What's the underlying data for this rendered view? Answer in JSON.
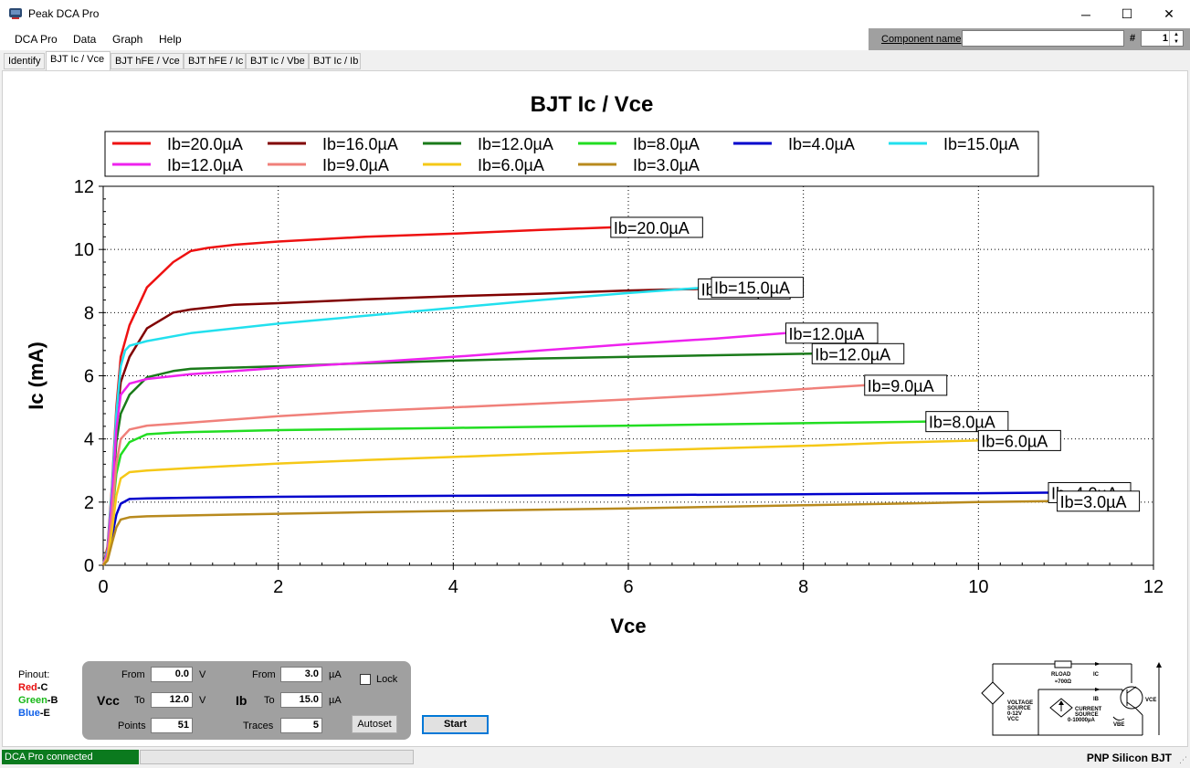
{
  "window": {
    "title": "Peak DCA Pro",
    "minimize": "─",
    "maximize": "☐",
    "close": "✕"
  },
  "menu": [
    "DCA Pro",
    "Data",
    "Graph",
    "Help"
  ],
  "component": {
    "label": "Component name",
    "value": "",
    "hash": "#",
    "number": "1",
    "up": "▲",
    "down": "▼"
  },
  "tabs": [
    "Identify",
    "BJT Ic / Vce",
    "BJT hFE / Vce",
    "BJT hFE / Ic",
    "BJT Ic / Vbe",
    "BJT Ic / Ib"
  ],
  "active_tab": 1,
  "chart_data": {
    "type": "line",
    "title": "BJT Ic / Vce",
    "xlabel": "Vce",
    "ylabel": "Ic (mA)",
    "xlim": [
      0,
      12
    ],
    "ylim": [
      0,
      12
    ],
    "xticks": [
      0,
      2,
      4,
      6,
      8,
      10,
      12
    ],
    "yticks": [
      0,
      2,
      4,
      6,
      8,
      10,
      12
    ],
    "grid": true,
    "legend_position": "top",
    "series": [
      {
        "name": "Ib=20.0µA",
        "color": "#ee1111",
        "x": [
          0,
          0.05,
          0.1,
          0.15,
          0.2,
          0.3,
          0.5,
          0.8,
          1.0,
          1.2,
          1.5,
          2,
          3,
          4,
          5,
          5.8
        ],
        "y": [
          0,
          0.6,
          2.5,
          5.0,
          6.6,
          7.6,
          8.8,
          9.6,
          9.95,
          10.05,
          10.15,
          10.25,
          10.4,
          10.5,
          10.62,
          10.7
        ]
      },
      {
        "name": "Ib=16.0µA",
        "color": "#800000",
        "x": [
          0,
          0.05,
          0.1,
          0.15,
          0.2,
          0.3,
          0.5,
          0.8,
          1.0,
          1.5,
          2,
          3,
          4,
          5,
          6,
          6.8
        ],
        "y": [
          0,
          0.5,
          2.2,
          4.5,
          5.8,
          6.6,
          7.5,
          8.0,
          8.1,
          8.25,
          8.3,
          8.42,
          8.52,
          8.6,
          8.7,
          8.75
        ]
      },
      {
        "name": "Ib=12.0µA",
        "color": "#1a7a1a",
        "x": [
          0,
          0.05,
          0.1,
          0.15,
          0.2,
          0.3,
          0.5,
          0.8,
          1.0,
          2,
          3,
          4,
          5,
          6,
          7,
          8.1
        ],
        "y": [
          0,
          0.4,
          2.0,
          3.9,
          4.8,
          5.4,
          5.95,
          6.15,
          6.22,
          6.3,
          6.4,
          6.48,
          6.55,
          6.6,
          6.65,
          6.7
        ]
      },
      {
        "name": "Ib=8.0µA",
        "color": "#22dd22",
        "x": [
          0,
          0.05,
          0.1,
          0.15,
          0.2,
          0.3,
          0.5,
          0.8,
          1.0,
          2,
          4,
          6,
          8,
          9.5,
          10.2
        ],
        "y": [
          0,
          0.3,
          1.5,
          2.9,
          3.5,
          3.9,
          4.15,
          4.2,
          4.22,
          4.28,
          4.35,
          4.42,
          4.5,
          4.55,
          4.55
        ]
      },
      {
        "name": "Ib=4.0µA",
        "color": "#0000cc",
        "x": [
          0,
          0.05,
          0.1,
          0.15,
          0.2,
          0.3,
          0.5,
          1,
          2,
          4,
          6,
          8,
          10,
          10.8
        ],
        "y": [
          0,
          0.2,
          0.9,
          1.6,
          1.95,
          2.1,
          2.12,
          2.14,
          2.17,
          2.2,
          2.22,
          2.25,
          2.28,
          2.3
        ]
      },
      {
        "name": "Ib=15.0µA",
        "color": "#22e0ee",
        "x": [
          0,
          0.05,
          0.1,
          0.15,
          0.2,
          0.25,
          0.3,
          0.5,
          1,
          2,
          3,
          4,
          5,
          6,
          6.8,
          6.95
        ],
        "y": [
          0,
          0.5,
          2.4,
          4.8,
          6.3,
          6.8,
          6.95,
          7.1,
          7.35,
          7.65,
          7.9,
          8.15,
          8.4,
          8.62,
          8.78,
          8.8
        ]
      },
      {
        "name": "Ib=12.0µA",
        "color": "#ee22ee",
        "x": [
          0,
          0.05,
          0.1,
          0.15,
          0.2,
          0.3,
          0.5,
          1,
          2,
          3,
          4,
          5,
          6,
          7,
          7.8
        ],
        "y": [
          0,
          0.4,
          2.1,
          4.3,
          5.4,
          5.75,
          5.9,
          6.05,
          6.25,
          6.42,
          6.6,
          6.8,
          7.0,
          7.18,
          7.35
        ]
      },
      {
        "name": "Ib=9.0µA",
        "color": "#f0807a",
        "x": [
          0,
          0.05,
          0.1,
          0.15,
          0.2,
          0.3,
          0.5,
          1,
          2,
          3,
          4,
          5,
          6,
          7,
          8,
          8.7
        ],
        "y": [
          0,
          0.3,
          1.6,
          3.2,
          4.0,
          4.3,
          4.42,
          4.52,
          4.72,
          4.88,
          5.0,
          5.12,
          5.25,
          5.4,
          5.58,
          5.7
        ]
      },
      {
        "name": "Ib=6.0µA",
        "color": "#f5c817",
        "x": [
          0,
          0.05,
          0.1,
          0.15,
          0.2,
          0.3,
          0.5,
          1,
          2,
          3,
          4,
          5,
          6,
          7,
          8,
          9,
          10
        ],
        "y": [
          0,
          0.2,
          1.1,
          2.2,
          2.75,
          2.95,
          3.0,
          3.08,
          3.22,
          3.33,
          3.43,
          3.53,
          3.62,
          3.7,
          3.78,
          3.88,
          3.95
        ]
      },
      {
        "name": "Ib=3.0µA",
        "color": "#b88a1e",
        "x": [
          0,
          0.05,
          0.1,
          0.15,
          0.2,
          0.3,
          0.5,
          1,
          2,
          3,
          4,
          5,
          6,
          7,
          8,
          9,
          10,
          10.8
        ],
        "y": [
          0,
          0.15,
          0.7,
          1.2,
          1.45,
          1.52,
          1.55,
          1.58,
          1.63,
          1.68,
          1.72,
          1.76,
          1.8,
          1.85,
          1.9,
          1.95,
          2.0,
          2.03
        ]
      }
    ],
    "end_labels": [
      {
        "text": "Ib=20.0µA",
        "x": 5.8,
        "y": 10.7
      },
      {
        "text": "Ib=16.0µA",
        "x": 6.8,
        "y": 8.75
      },
      {
        "text": "Ib=15.0µA",
        "x": 6.95,
        "y": 8.8
      },
      {
        "text": "Ib=12.0µA",
        "x": 7.8,
        "y": 7.35
      },
      {
        "text": "Ib=12.0µA",
        "x": 8.1,
        "y": 6.7
      },
      {
        "text": "Ib=9.0µA",
        "x": 8.7,
        "y": 5.7
      },
      {
        "text": "Ib=8.0µA",
        "x": 9.4,
        "y": 4.55
      },
      {
        "text": "Ib=6.0µA",
        "x": 10.0,
        "y": 3.95
      },
      {
        "text": "Ib=4.0µA",
        "x": 10.8,
        "y": 2.3
      },
      {
        "text": "Ib=3.0µA",
        "x": 10.9,
        "y": 2.03
      }
    ]
  },
  "pinout": {
    "title": "Pinout:",
    "pins": [
      {
        "color": "Red",
        "sep": "-",
        "pin": "C",
        "hex": "#e81010"
      },
      {
        "color": "Green",
        "sep": "-",
        "pin": "B",
        "hex": "#18b818"
      },
      {
        "color": "Blue",
        "sep": "-",
        "pin": "E",
        "hex": "#1060e8"
      }
    ]
  },
  "controls": {
    "vcc": {
      "label": "Vcc",
      "from_label": "From",
      "from": "0.0",
      "to_label": "To",
      "to": "12.0",
      "unit": "V",
      "points_label": "Points",
      "points": "51"
    },
    "ib": {
      "label": "Ib",
      "from_label": "From",
      "from": "3.0",
      "to_label": "To",
      "to": "15.0",
      "unit": "µA",
      "traces_label": "Traces",
      "traces": "5"
    },
    "lock": "Lock",
    "autoset": "Autoset",
    "start": "Start"
  },
  "schematic": {
    "rload": "RLOAD",
    "rload_value": "≈700Ω",
    "ic": "IC",
    "ib": "IB",
    "vbe": "VBE",
    "vce": "VCE",
    "vsrc": [
      "VOLTAGE",
      "SOURCE",
      "0-12V",
      "VCC"
    ],
    "isrc": [
      "CURRENT",
      "SOURCE",
      "0-10000µA"
    ]
  },
  "status": {
    "connection": "DCA Pro connected",
    "type": "PNP  Silicon BJT",
    "grip": "⋰"
  }
}
